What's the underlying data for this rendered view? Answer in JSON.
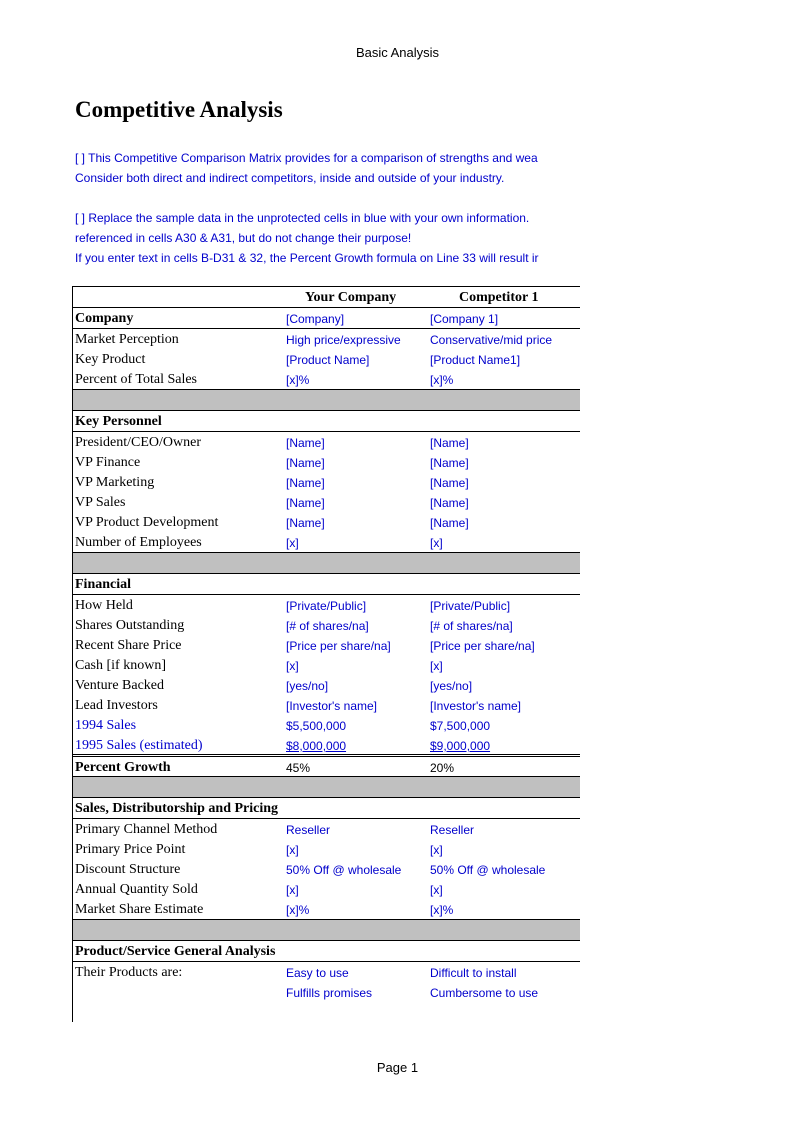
{
  "page": {
    "header": "Basic Analysis",
    "footer": "Page 1",
    "title": "Competitive Analysis"
  },
  "notes": [
    "[ ]  This Competitive Comparison Matrix provides for a comparison of strengths and wea",
    "Consider both direct and indirect competitors, inside and outside of your industry.",
    "",
    "[ ]  Replace the sample data in the unprotected cells in blue with your own information.",
    "referenced in cells A30 & A31, but do not change their purpose!",
    "If you enter text in cells B-D31 & 32, the Percent Growth formula on Line 33 will result ir"
  ],
  "columns": {
    "your_company": "Your Company",
    "competitor_1": "Competitor 1"
  },
  "sections": {
    "company": {
      "heading": "Company",
      "heading_values": [
        "[Company]",
        "[Company 1]"
      ],
      "rows": [
        {
          "label": "Market Perception",
          "values": [
            "High price/expressive",
            "Conservative/mid price"
          ]
        },
        {
          "label": "Key Product",
          "values": [
            "[Product Name]",
            "[Product Name1]"
          ]
        },
        {
          "label": "Percent of Total Sales",
          "values": [
            "[x]%",
            "[x]%"
          ]
        }
      ]
    },
    "personnel": {
      "heading": "Key Personnel",
      "rows": [
        {
          "label": "President/CEO/Owner",
          "values": [
            "[Name]",
            "[Name]"
          ]
        },
        {
          "label": "VP Finance",
          "values": [
            "[Name]",
            "[Name]"
          ]
        },
        {
          "label": "VP Marketing",
          "values": [
            "[Name]",
            "[Name]"
          ]
        },
        {
          "label": "VP Sales",
          "values": [
            "[Name]",
            "[Name]"
          ]
        },
        {
          "label": "VP Product Development",
          "values": [
            "[Name]",
            "[Name]"
          ]
        },
        {
          "label": "Number of Employees",
          "values": [
            "[x]",
            "[x]"
          ]
        }
      ]
    },
    "financial": {
      "heading": "Financial",
      "rows": [
        {
          "label": "How Held",
          "values": [
            "[Private/Public]",
            "[Private/Public]"
          ]
        },
        {
          "label": "Shares Outstanding",
          "values": [
            "[# of shares/na]",
            "[# of shares/na]"
          ]
        },
        {
          "label": "Recent Share Price",
          "values": [
            "[Price per share/na]",
            "[Price per share/na]"
          ]
        },
        {
          "label": "Cash [if known]",
          "values": [
            "[x]",
            "[x]"
          ]
        },
        {
          "label": "Venture Backed",
          "values": [
            "[yes/no]",
            "[yes/no]"
          ]
        },
        {
          "label": "Lead Investors",
          "values": [
            "[Investor's name]",
            "[Investor's name]"
          ]
        },
        {
          "label": "1994 Sales",
          "values": [
            "$5,500,000",
            "$7,500,000"
          ]
        },
        {
          "label": "1995 Sales (estimated)",
          "values": [
            "$8,000,000",
            "$9,000,000"
          ]
        }
      ],
      "growth": {
        "label": "Percent Growth",
        "values": [
          "45%",
          "20%"
        ]
      }
    },
    "sales": {
      "heading": "Sales, Distributorship and Pricing",
      "rows": [
        {
          "label": "Primary Channel Method",
          "values": [
            "Reseller",
            "Reseller"
          ]
        },
        {
          "label": "Primary Price Point",
          "values": [
            "[x]",
            "[x]"
          ]
        },
        {
          "label": "Discount Structure",
          "values": [
            "50% Off @ wholesale",
            "50% Off @ wholesale"
          ]
        },
        {
          "label": "Annual Quantity Sold",
          "values": [
            "[x]",
            "[x]"
          ]
        },
        {
          "label": "Market Share Estimate",
          "values": [
            "[x]%",
            "[x]%"
          ]
        }
      ]
    },
    "product": {
      "heading": "Product/Service General Analysis",
      "rows": [
        {
          "label": "Their Products are:",
          "values": [
            "Easy to use",
            "Difficult to install"
          ]
        },
        {
          "label": "",
          "values": [
            "Fulfills promises",
            "Cumbersome to use"
          ]
        }
      ]
    }
  }
}
